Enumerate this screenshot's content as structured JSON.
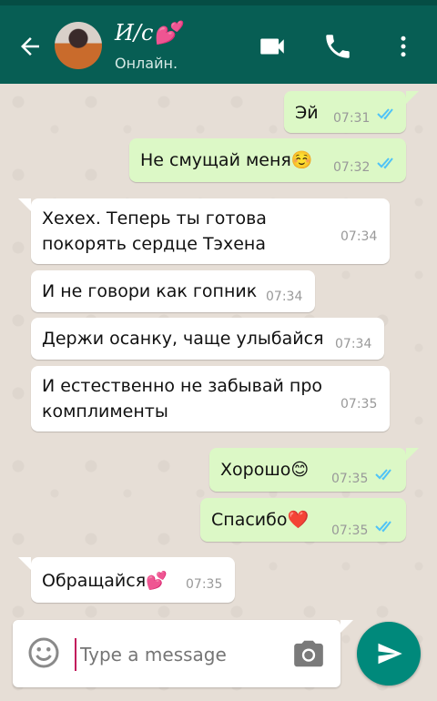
{
  "header": {
    "contact_name": "И/с💕",
    "status": "Онлайн."
  },
  "messages": [
    {
      "dir": "out",
      "text": "Эй",
      "time": "07:31",
      "read": true
    },
    {
      "dir": "out",
      "text": "Не смущай меня☺️",
      "time": "07:32",
      "read": true
    },
    {
      "dir": "in",
      "lines": [
        "Хехех. Теперь ты готова",
        "покорять сердце Тэхена"
      ],
      "time": "07:34"
    },
    {
      "dir": "in",
      "text": "И не говори как гопник",
      "time": "07:34"
    },
    {
      "dir": "in",
      "text": "Держи осанку, чаще улыбайся",
      "time": "07:34"
    },
    {
      "dir": "in",
      "lines": [
        "И естественно не забывай про",
        "комплименты"
      ],
      "time": "07:35"
    },
    {
      "dir": "out",
      "text": "Хорошо😊",
      "time": "07:35",
      "read": true
    },
    {
      "dir": "out",
      "text": "Спасибо❤️",
      "time": "07:35",
      "read": true
    },
    {
      "dir": "in",
      "text": "Обращайся💕",
      "time": "07:35"
    }
  ],
  "composer": {
    "placeholder": "Type a message"
  },
  "colors": {
    "header": "#075e54",
    "outgoing_bubble": "#dcf8c6",
    "incoming_bubble": "#ffffff",
    "read_ticks": "#4fc3f7",
    "send_button": "#00897b"
  }
}
